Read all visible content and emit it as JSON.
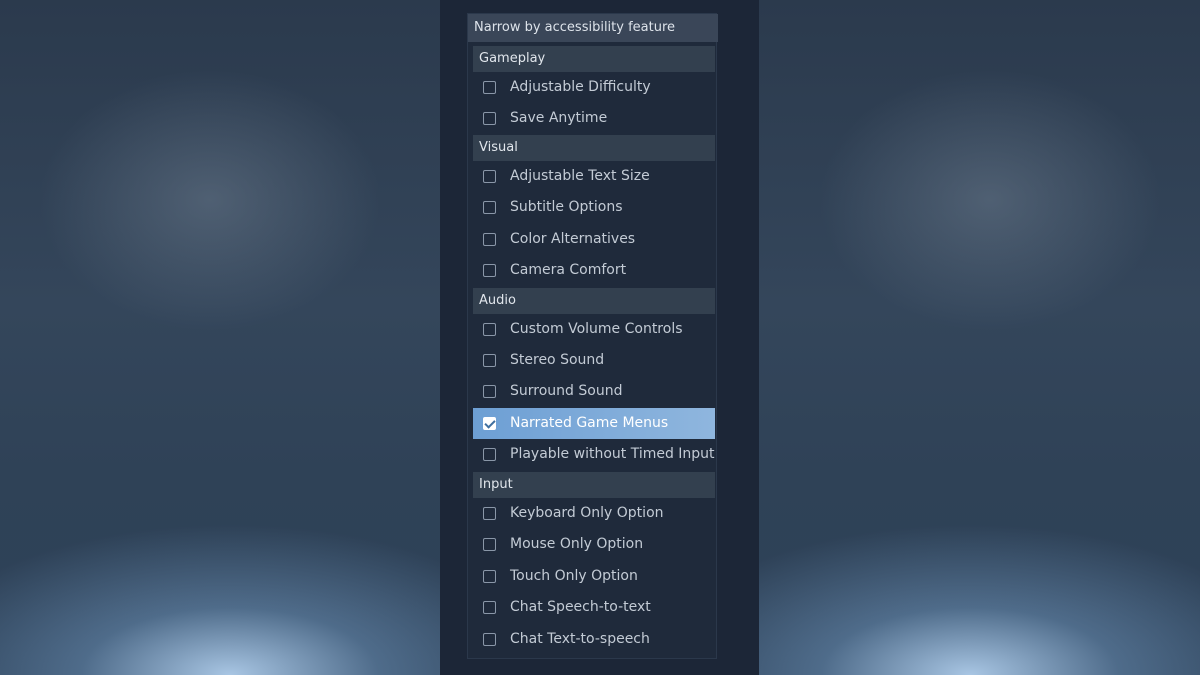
{
  "panel": {
    "title": "Narrow by accessibility feature"
  },
  "categories": {
    "gameplay": {
      "label": "Gameplay",
      "options": [
        {
          "label": "Adjustable Difficulty",
          "checked": false
        },
        {
          "label": "Save Anytime",
          "checked": false
        }
      ]
    },
    "visual": {
      "label": "Visual",
      "options": [
        {
          "label": "Adjustable Text Size",
          "checked": false
        },
        {
          "label": "Subtitle Options",
          "checked": false
        },
        {
          "label": "Color Alternatives",
          "checked": false
        },
        {
          "label": "Camera Comfort",
          "checked": false
        }
      ]
    },
    "audio": {
      "label": "Audio",
      "options": [
        {
          "label": "Custom Volume Controls",
          "checked": false
        },
        {
          "label": "Stereo Sound",
          "checked": false
        },
        {
          "label": "Surround Sound",
          "checked": false
        },
        {
          "label": "Narrated Game Menus",
          "checked": true
        },
        {
          "label": "Playable without Timed Input",
          "checked": false
        }
      ]
    },
    "input": {
      "label": "Input",
      "options": [
        {
          "label": "Keyboard Only Option",
          "checked": false
        },
        {
          "label": "Mouse Only Option",
          "checked": false
        },
        {
          "label": "Touch Only Option",
          "checked": false
        },
        {
          "label": "Chat Speech-to-text",
          "checked": false
        },
        {
          "label": "Chat Text-to-speech",
          "checked": false
        }
      ]
    }
  },
  "colors": {
    "selected_highlight": "#7aa7d8",
    "panel_background": "#1f2a3b",
    "category_header": "#33404f"
  }
}
